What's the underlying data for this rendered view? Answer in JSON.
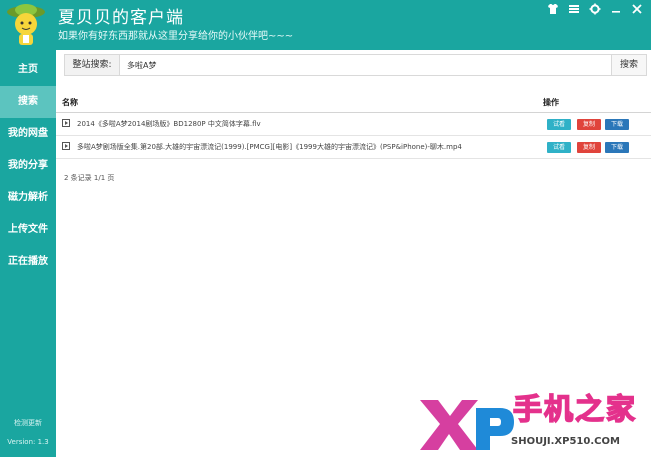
{
  "header": {
    "title": "夏贝贝的客户端",
    "slogan": "如果你有好东西那就从这里分享给你的小伙伴吧~~~"
  },
  "sidebar": {
    "items": [
      {
        "label": "主页"
      },
      {
        "label": "搜索"
      },
      {
        "label": "我的网盘"
      },
      {
        "label": "我的分享"
      },
      {
        "label": "磁力解析"
      },
      {
        "label": "上传文件"
      },
      {
        "label": "正在播放"
      }
    ],
    "check_update": "检测更新",
    "version": "Version: 1.3"
  },
  "search": {
    "label": "整站搜索:",
    "value": "多啦A梦",
    "button": "搜索"
  },
  "table": {
    "col_name": "名称",
    "col_op": "操作",
    "rows": [
      {
        "name": "2014《多啦A梦2014剧场版》BD1280P 中文简体字幕.flv"
      },
      {
        "name": "多啦A梦剧场版全集.第20部.大雄的宇宙漂流记(1999).[PMCG][电影]《1999大雄的宇宙漂流记》(PSP&iPhone)-聊木.mp4"
      }
    ],
    "actions": {
      "preview": "试看",
      "copy": "复制",
      "download": "下载"
    }
  },
  "summary": "2 条记录 1/1 页",
  "watermark": {
    "text": "手机之家",
    "domain": "SHOUJI.XP510.COM"
  },
  "colors": {
    "teal": "#1aa6a0",
    "active": "#5cc4bf",
    "red": "#e0443c",
    "blue": "#2b77b9",
    "cyan": "#2fb1c7"
  }
}
